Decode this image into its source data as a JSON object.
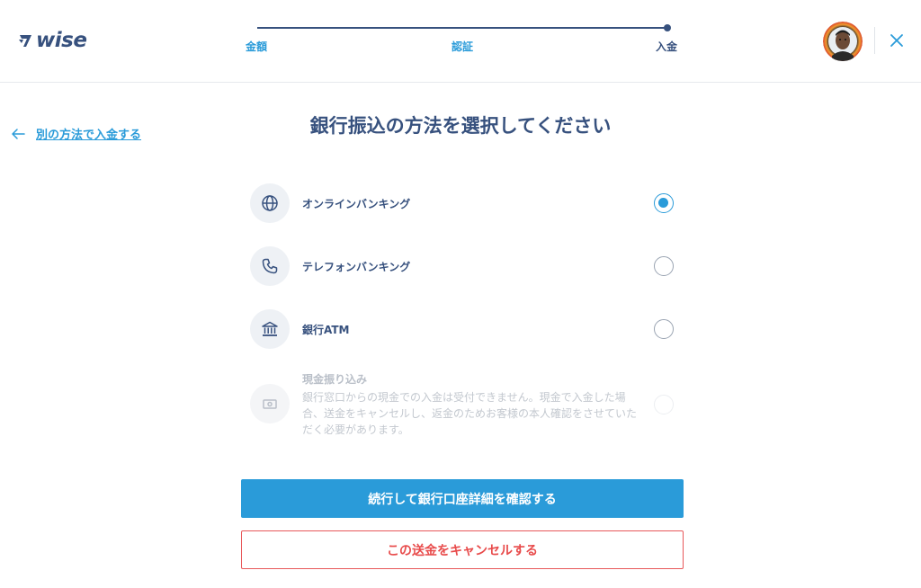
{
  "brand": {
    "name": "wise",
    "color": "#37517e",
    "accent": "#2a9bd9"
  },
  "stepper": {
    "steps": [
      {
        "label": "金額",
        "state": "done"
      },
      {
        "label": "認証",
        "state": "done"
      },
      {
        "label": "入金",
        "state": "current"
      }
    ]
  },
  "header": {
    "avatar_icon": "user-avatar",
    "close_icon": "close-icon"
  },
  "back_link": {
    "label": "別の方法で入金する",
    "icon": "arrow-left-icon"
  },
  "page_title": "銀行振込の方法を選択してください",
  "options": [
    {
      "label": "オンラインバンキング",
      "icon": "globe-icon",
      "selected": true,
      "disabled": false
    },
    {
      "label": "テレフォンバンキング",
      "icon": "phone-icon",
      "selected": false,
      "disabled": false
    },
    {
      "label": "銀行ATM",
      "icon": "bank-icon",
      "selected": false,
      "disabled": false
    },
    {
      "label": "現金振り込み",
      "icon": "cash-icon",
      "selected": false,
      "disabled": true,
      "description": "銀行窓口からの現金での入金は受付できません。現金で入金した場合、送金をキャンセルし、返金のためお客様の本人確認をさせていただく必要があります。"
    }
  ],
  "buttons": {
    "continue_label": "続行して銀行口座詳細を確認する",
    "cancel_label": "この送金をキャンセルする"
  },
  "colors": {
    "primary": "#2a9bd9",
    "danger": "#e84b4b",
    "text": "#37517e",
    "muted": "#c3c8cf"
  }
}
